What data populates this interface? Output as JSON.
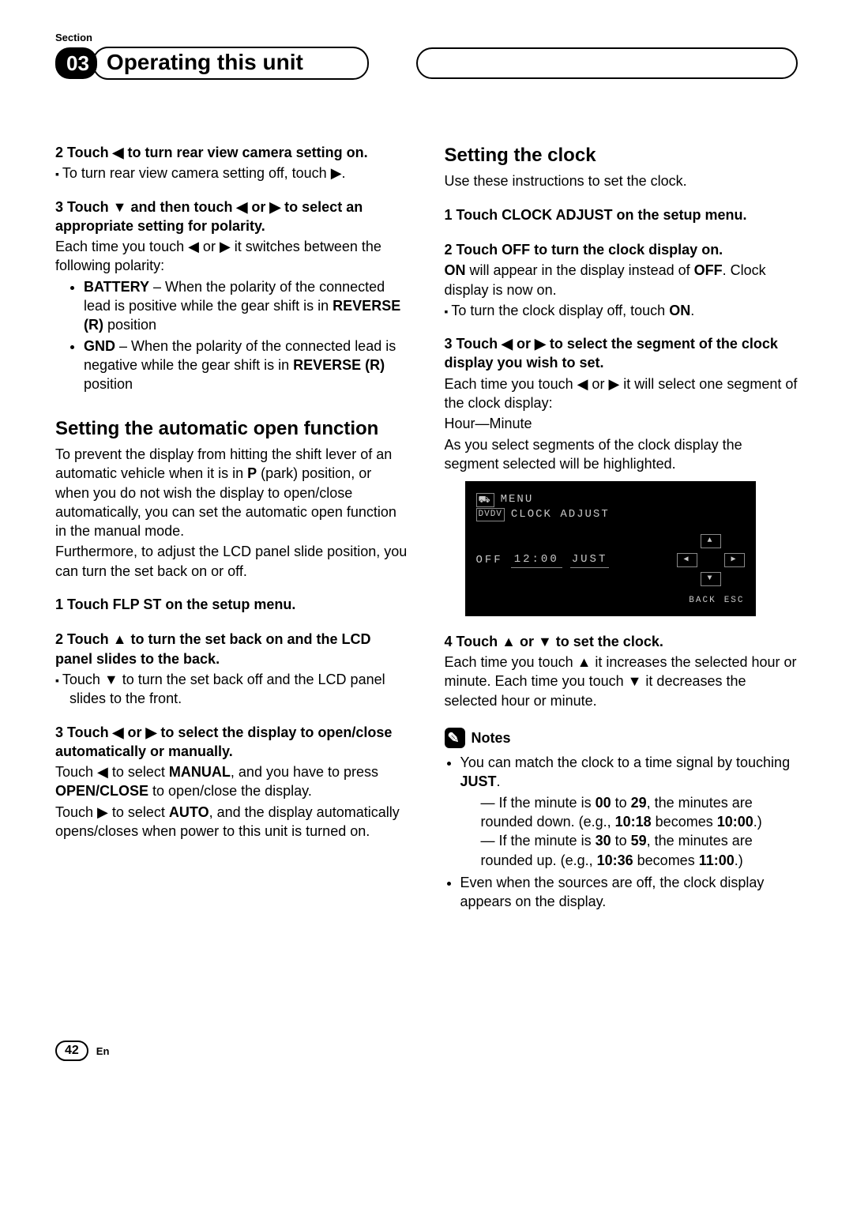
{
  "header": {
    "section_label": "Section",
    "section_number": "03",
    "chapter_title": "Operating this unit"
  },
  "left": {
    "step2_head": "2   Touch ◀ to turn rear view camera setting on.",
    "step2_bullet": "To turn rear view camera setting off, touch ▶.",
    "step3_head": "3   Touch ▼ and then touch ◀ or ▶ to select an appropriate setting for polarity.",
    "step3_para": "Each time you touch ◀ or ▶ it switches between the following polarity:",
    "step3_li1_a": "BATTERY",
    "step3_li1_b": " – When the polarity of the connected lead is positive while the gear shift is in ",
    "step3_li1_c": "REVERSE (R)",
    "step3_li1_d": " position",
    "step3_li2_a": "GND",
    "step3_li2_b": " – When the polarity of the connected lead is negative while the gear shift is in ",
    "step3_li2_c": "REVERSE (R)",
    "step3_li2_d": " position",
    "h2_auto": "Setting the automatic open function",
    "auto_para1_a": "To prevent the display from hitting the shift lever of an automatic vehicle when it is in ",
    "auto_para1_b": "P",
    "auto_para1_c": " (park) position, or when you do not wish the display to open/close automatically, you can set the automatic open function in the manual mode.",
    "auto_para2": "Furthermore, to adjust the LCD panel slide position, you can turn the set back on or off.",
    "auto_s1": "1   Touch FLP ST on the setup menu.",
    "auto_s2": "2   Touch ▲ to turn the set back on and the LCD panel slides to the back.",
    "auto_s2_bullet": "Touch ▼ to turn the set back off and the LCD panel slides to the front.",
    "auto_s3": "3   Touch ◀ or ▶ to select the display to open/close automatically or manually.",
    "auto_s3_p1_a": "Touch ◀ to select ",
    "auto_s3_p1_b": "MANUAL",
    "auto_s3_p1_c": ", and you have to press ",
    "auto_s3_p1_d": "OPEN/CLOSE",
    "auto_s3_p1_e": " to open/close the display.",
    "auto_s3_p2_a": "Touch ▶ to select ",
    "auto_s3_p2_b": "AUTO",
    "auto_s3_p2_c": ", and the display automatically opens/closes when power to this unit is turned on."
  },
  "right": {
    "h2_clock": "Setting the clock",
    "clock_intro": "Use these instructions to set the clock.",
    "c1": "1   Touch CLOCK ADJUST on the setup menu.",
    "c2": "2   Touch OFF to turn the clock display on.",
    "c2_p_a": "ON",
    "c2_p_b": " will appear in the display instead of ",
    "c2_p_c": "OFF",
    "c2_p_d": ". Clock display is now on.",
    "c2_bullet_a": "To turn the clock display off, touch ",
    "c2_bullet_b": "ON",
    "c2_bullet_c": ".",
    "c3": "3   Touch ◀ or ▶ to select the segment of the clock display you wish to set.",
    "c3_p1": "Each time you touch ◀ or ▶ it will select one segment of the clock display:",
    "c3_p2": "Hour—Minute",
    "c3_p3": "As you select segments of the clock display the segment selected will be highlighted.",
    "scr": {
      "menu": "MENU",
      "dvdv": "DVDV",
      "clock_adjust": "CLOCK ADJUST",
      "off": "OFF",
      "time": "12:00",
      "just": "JUST",
      "back": "BACK",
      "esc": "ESC"
    },
    "c4": "4   Touch ▲ or ▼ to set the clock.",
    "c4_p": "Each time you touch ▲ it increases the selected hour or minute. Each time you touch ▼ it decreases the selected hour or minute.",
    "notes_label": "Notes",
    "n1_a": "You can match the clock to a time signal by touching ",
    "n1_b": "JUST",
    "n1_c": ".",
    "n1_d1_a": "If the minute is ",
    "n1_d1_b": "00",
    "n1_d1_c": " to ",
    "n1_d1_d": "29",
    "n1_d1_e": ", the minutes are rounded down. (e.g., ",
    "n1_d1_f": "10:18",
    "n1_d1_g": " becomes ",
    "n1_d1_h": "10:00",
    "n1_d1_i": ".)",
    "n1_d2_a": "If the minute is ",
    "n1_d2_b": "30",
    "n1_d2_c": " to ",
    "n1_d2_d": "59",
    "n1_d2_e": ", the minutes are rounded up. (e.g., ",
    "n1_d2_f": "10:36",
    "n1_d2_g": " becomes ",
    "n1_d2_h": "11:00",
    "n1_d2_i": ".)",
    "n2": "Even when the sources are off, the clock display appears on the display."
  },
  "footer": {
    "page": "42",
    "lang": "En"
  }
}
